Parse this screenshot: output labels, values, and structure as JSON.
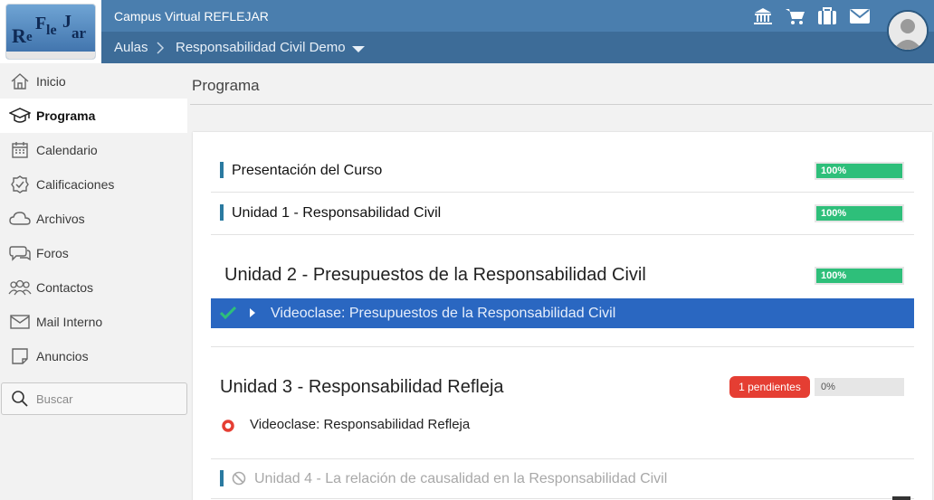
{
  "header": {
    "logo_text": "ReFleJar",
    "app_title": "Campus Virtual REFLEJAR",
    "breadcrumb": [
      "Aulas",
      "Responsabilidad Civil Demo"
    ],
    "icons": [
      "institution-icon",
      "cart-icon",
      "briefcase-icon",
      "mail-icon"
    ]
  },
  "sidebar": {
    "items": [
      {
        "label": "Inicio",
        "icon": "home-icon"
      },
      {
        "label": "Programa",
        "icon": "graduation-cap-icon"
      },
      {
        "label": "Calendario",
        "icon": "calendar-icon"
      },
      {
        "label": "Calificaciones",
        "icon": "check-badge-icon"
      },
      {
        "label": "Archivos",
        "icon": "cloud-icon"
      },
      {
        "label": "Foros",
        "icon": "chat-icon"
      },
      {
        "label": "Contactos",
        "icon": "people-icon"
      },
      {
        "label": "Mail Interno",
        "icon": "envelope-icon"
      },
      {
        "label": "Anuncios",
        "icon": "note-icon"
      }
    ],
    "search_placeholder": "Buscar"
  },
  "main": {
    "page_title": "Programa",
    "rows": [
      {
        "title": "Presentación del Curso",
        "progress": "100%"
      },
      {
        "title": "Unidad 1 - Responsabilidad Civil",
        "progress": "100%"
      }
    ],
    "unit2": {
      "title": "Unidad 2 - Presupuestos de la Responsabilidad Civil",
      "progress": "100%",
      "lesson": "Videoclase: Presupuestos de la Responsabilidad Civil"
    },
    "unit3": {
      "title": "Unidad 3 - Responsabilidad Refleja",
      "badge": "1 pendientes",
      "progress": "0%",
      "lesson": "Videoclase: Responsabilidad Refleja"
    },
    "unit4": {
      "title": "Unidad 4 - La relación de causalidad en la Responsabilidad Civil"
    }
  },
  "colors": {
    "topbar": "#4a7eae",
    "subbar": "#3d6c98",
    "progress_fill": "#2ebf7a",
    "active_lesson": "#2a67c1",
    "badge": "#e53e33"
  }
}
